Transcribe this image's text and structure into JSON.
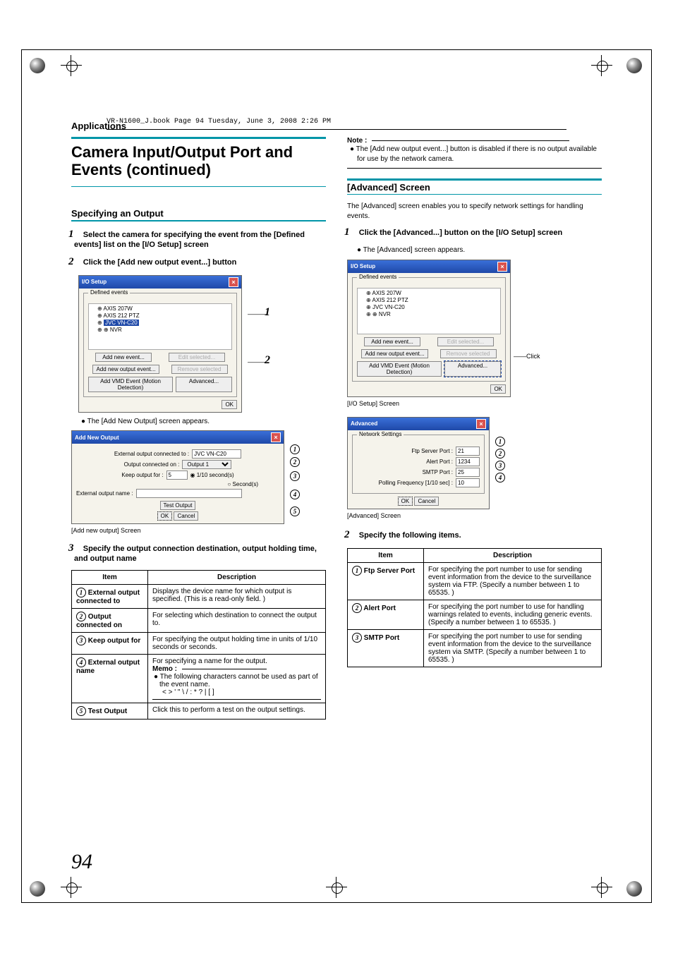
{
  "header_line": "VR-N1600_J.book  Page 94  Tuesday, June 3, 2008  2:26 PM",
  "section_label": "Applications",
  "title": "Camera Input/Output Port and Events (continued)",
  "left": {
    "subhead": "Specifying an Output",
    "step1": "Select the camera for specifying the event from the [Defined events] list on the [I/O Setup] screen",
    "step2": "Click the [Add new output event...] button",
    "shot1": {
      "title": "I/O Setup",
      "group": "Defined events",
      "tree": [
        "AXIS 207W",
        "AXIS 212 PTZ",
        "JVC VN-C20",
        "NVR"
      ],
      "btn_add_event": "Add new event...",
      "btn_edit": "Edit selected...",
      "btn_add_output": "Add new output event...",
      "btn_remove": "Remove selected",
      "btn_vmd": "Add VMD Event (Motion Detection)",
      "btn_adv": "Advanced...",
      "btn_ok": "OK",
      "callout1": "1",
      "callout2": "2"
    },
    "after_shot1": "The [Add New Output] screen appears.",
    "shot2": {
      "title": "Add New Output",
      "ext_conn_label": "External output connected to :",
      "ext_conn_val": "JVC VN-C20",
      "out_on_label": "Output connected on :",
      "out_on_val": "Output 1",
      "keep_label": "Keep output for :",
      "keep_val": "5",
      "radio1": "1/10 second(s)",
      "radio2": "Second(s)",
      "ext_name_label": "External output name :",
      "test_btn": "Test Output",
      "ok": "OK",
      "cancel": "Cancel"
    },
    "shot2_caption": "[Add new output] Screen",
    "step3": "Specify the output connection destination, output holding time, and output name",
    "table": {
      "h1": "Item",
      "h2": "Description",
      "r1i": "External output connected to",
      "r1d": "Displays the device name for which output is specified.  (This is a read-only field. )",
      "r2i": "Output connected on",
      "r2d": "For selecting which destination to connect the output to.",
      "r3i": "Keep output for",
      "r3d": "For specifying the output holding time in units of 1/10 seconds or seconds.",
      "r4i": "External output name",
      "r4d_intro": "For specifying a name for the output.",
      "r4d_memo_title": "Memo :",
      "r4d_memo_b1": "The following characters cannot be used as part of the event name.",
      "r4d_memo_chars": "< > ' \" \\ / : * ? | [ ]",
      "r5i": "Test Output",
      "r5d": "Click this to perform a test on the output settings."
    }
  },
  "right": {
    "note_title": "Note :",
    "note_b1": "The [Add new output event...] button is disabled if there is no output available for use by the network camera.",
    "adv_head": "[Advanced] Screen",
    "adv_intro": "The [Advanced] screen enables you to specify network settings for handling events.",
    "step1": "Click the [Advanced...] button on the [I/O Setup] screen",
    "step1_b": "The [Advanced] screen appears.",
    "shot1_caption": "[I/O Setup] Screen",
    "click_label": "Click",
    "shot2": {
      "title": "Advanced",
      "group": "Network Settings",
      "ftp_label": "Ftp Server Port :",
      "ftp_val": "21",
      "alert_label": "Alert Port :",
      "alert_val": "1234",
      "smtp_label": "SMTP Port :",
      "smtp_val": "25",
      "poll_label": "Polling Frequency [1/10 sec] :",
      "poll_val": "10",
      "ok": "OK",
      "cancel": "Cancel"
    },
    "shot2_caption": "[Advanced] Screen",
    "step2": "Specify the following items.",
    "table": {
      "h1": "Item",
      "h2": "Description",
      "r1i": "Ftp Server Port",
      "r1d": "For specifying the port number to use for sending event information from the device to the surveillance system via FTP. (Specify a number between 1 to 65535. )",
      "r2i": "Alert Port",
      "r2d": "For specifying the port number to use for handling warnings related to events, including generic events. (Specify a number between 1 to 65535. )",
      "r3i": "SMTP Port",
      "r3d": "For specifying the port number to use for sending event information from the device to the surveillance system via SMTP. (Specify a number between 1 to 65535. )"
    }
  },
  "page_number": "94"
}
